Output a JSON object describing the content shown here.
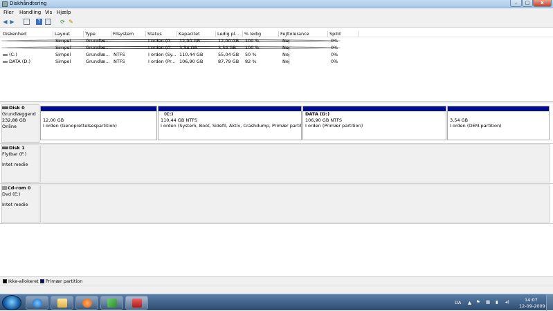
{
  "window": {
    "title": "Diskhåndtering",
    "close_label": "x"
  },
  "menu": [
    "Filer",
    "Handling",
    "Vis",
    "Hjælp"
  ],
  "toolbar_icons": [
    "back-arrow-icon",
    "forward-arrow-icon",
    "console-tree-icon",
    "help-icon",
    "properties-icon",
    "refresh-icon",
    "export-icon"
  ],
  "volume_columns": [
    "Diskenhed",
    "Layout",
    "Type",
    "Filsystem",
    "Status",
    "Kapacitet",
    "Ledig pl...",
    "% ledig",
    "Fejltolerance",
    "Spild"
  ],
  "volume_rows": [
    {
      "name": "",
      "layout": "Simpel",
      "type": "Grundlæ...",
      "fs": "",
      "status": "I orden (G...",
      "capacity": "12,00 GB",
      "free": "12,00 GB",
      "pct": "100 %",
      "fault": "Nej",
      "overhead": "0%"
    },
    {
      "name": "",
      "layout": "Simpel",
      "type": "Grundlæ...",
      "fs": "",
      "status": "I orden (O...",
      "capacity": "3,54 GB",
      "free": "3,54 GB",
      "pct": "100 %",
      "fault": "Nej",
      "overhead": "0%"
    },
    {
      "name": "(C:)",
      "layout": "Simpel",
      "type": "Grundlæ...",
      "fs": "NTFS",
      "status": "I orden (Sy...",
      "capacity": "110,44 GB",
      "free": "55,04 GB",
      "pct": "50 %",
      "fault": "Nej",
      "overhead": "0%"
    },
    {
      "name": "DATA (D:)",
      "layout": "Simpel",
      "type": "Grundlæ...",
      "fs": "NTFS",
      "status": "I orden (Pr...",
      "capacity": "106,90 GB",
      "free": "87,79 GB",
      "pct": "82 %",
      "fault": "Nej",
      "overhead": "0%"
    }
  ],
  "disks": [
    {
      "name": "Disk 0",
      "type": "Grundlæggend",
      "size": "232,88 GB",
      "state": "Online",
      "partitions": [
        {
          "label": "",
          "size": "12,00 GB",
          "status": "I orden (Genoprettelsespartition)"
        },
        {
          "label": "(C:)",
          "size": "110,44 GB NTFS",
          "status": "I orden (System, Boot, Sidefil, Aktiv, Crashdump, Primær partition)"
        },
        {
          "label": "DATA (D:)",
          "size": "106,90 GB NTFS",
          "status": "I orden (Primær partition)"
        },
        {
          "label": "",
          "size": "3,54 GB",
          "status": "I orden (OEM-partition)"
        }
      ]
    },
    {
      "name": "Disk 1",
      "type": "Flytbar (F:)",
      "size": "",
      "state": "Intet medie"
    },
    {
      "name": "Cd-rom 0",
      "type": "Dvd (E:)",
      "size": "",
      "state": "Intet medie"
    }
  ],
  "legend": [
    {
      "label": "Ikke-allokeret",
      "color": "#000000"
    },
    {
      "label": "Primær partition",
      "color": "#000c8c"
    }
  ],
  "taskbar": {
    "apps": [
      "internet-explorer-icon",
      "explorer-folder-icon",
      "media-player-icon",
      "network-app-icon",
      "disk-management-icon"
    ],
    "language": "DA",
    "time": "14:07",
    "date": "12-09-2009"
  }
}
